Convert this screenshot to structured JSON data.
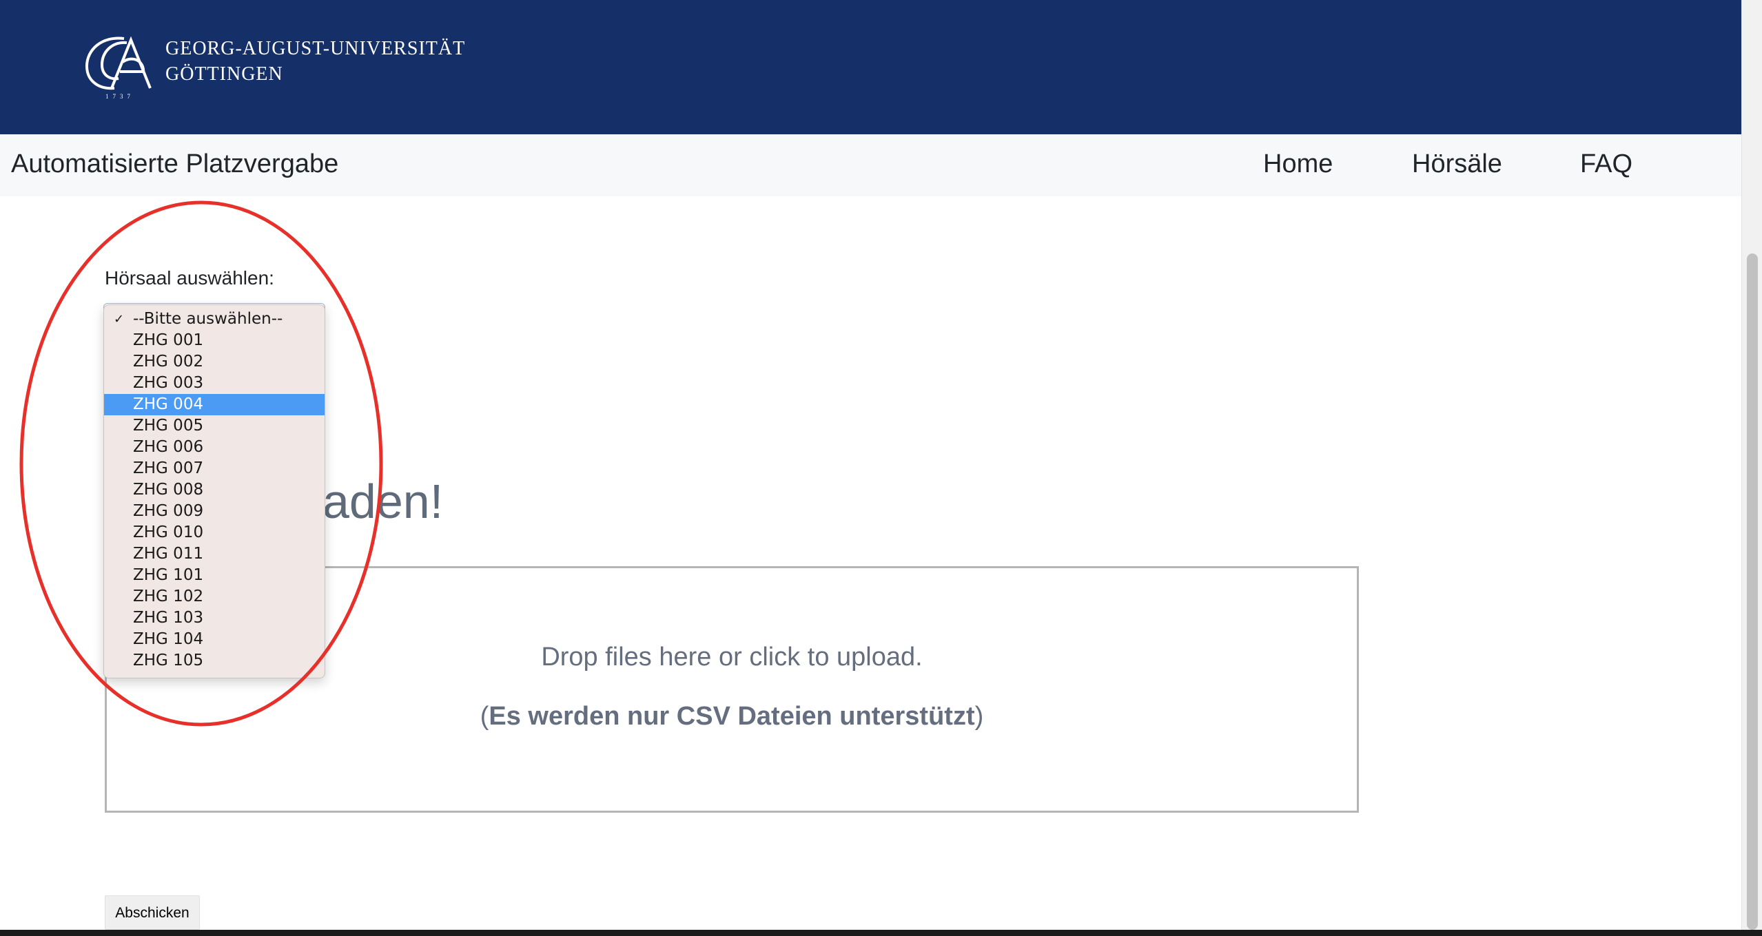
{
  "header": {
    "university_line1": "GEORG-AUGUST-UNIVERSITÄT",
    "university_line2": "GÖTTINGEN",
    "logo_year": "1737",
    "bg_color": "#153068"
  },
  "navbar": {
    "brand": "Automatisierte Platzvergabe",
    "links": [
      {
        "label": "Home"
      },
      {
        "label": "Hörsäle"
      },
      {
        "label": "FAQ"
      }
    ]
  },
  "form": {
    "select_label": "Hörsaal auswählen:",
    "select_options": [
      "--Bitte auswählen--",
      "ZHG 001",
      "ZHG 002",
      "ZHG 003",
      "ZHG 004",
      "ZHG 005",
      "ZHG 006",
      "ZHG 007",
      "ZHG 008",
      "ZHG 009",
      "ZHG 010",
      "ZHG 011",
      "ZHG 101",
      "ZHG 102",
      "ZHG 103",
      "ZHG 104",
      "ZHG 105"
    ],
    "selected_option": "--Bitte auswählen--",
    "highlighted_option": "ZHG 004",
    "upload_heading_visible": "aden!",
    "dropzone_message": "Drop files here or click to upload.",
    "dropzone_note_open": "(",
    "dropzone_note_bold": "Es werden nur CSV Dateien unterstützt",
    "dropzone_note_close": ")",
    "submit_label": "Abschicken"
  },
  "colors": {
    "annotation": "#e8302a",
    "highlight": "#4b9af3"
  }
}
